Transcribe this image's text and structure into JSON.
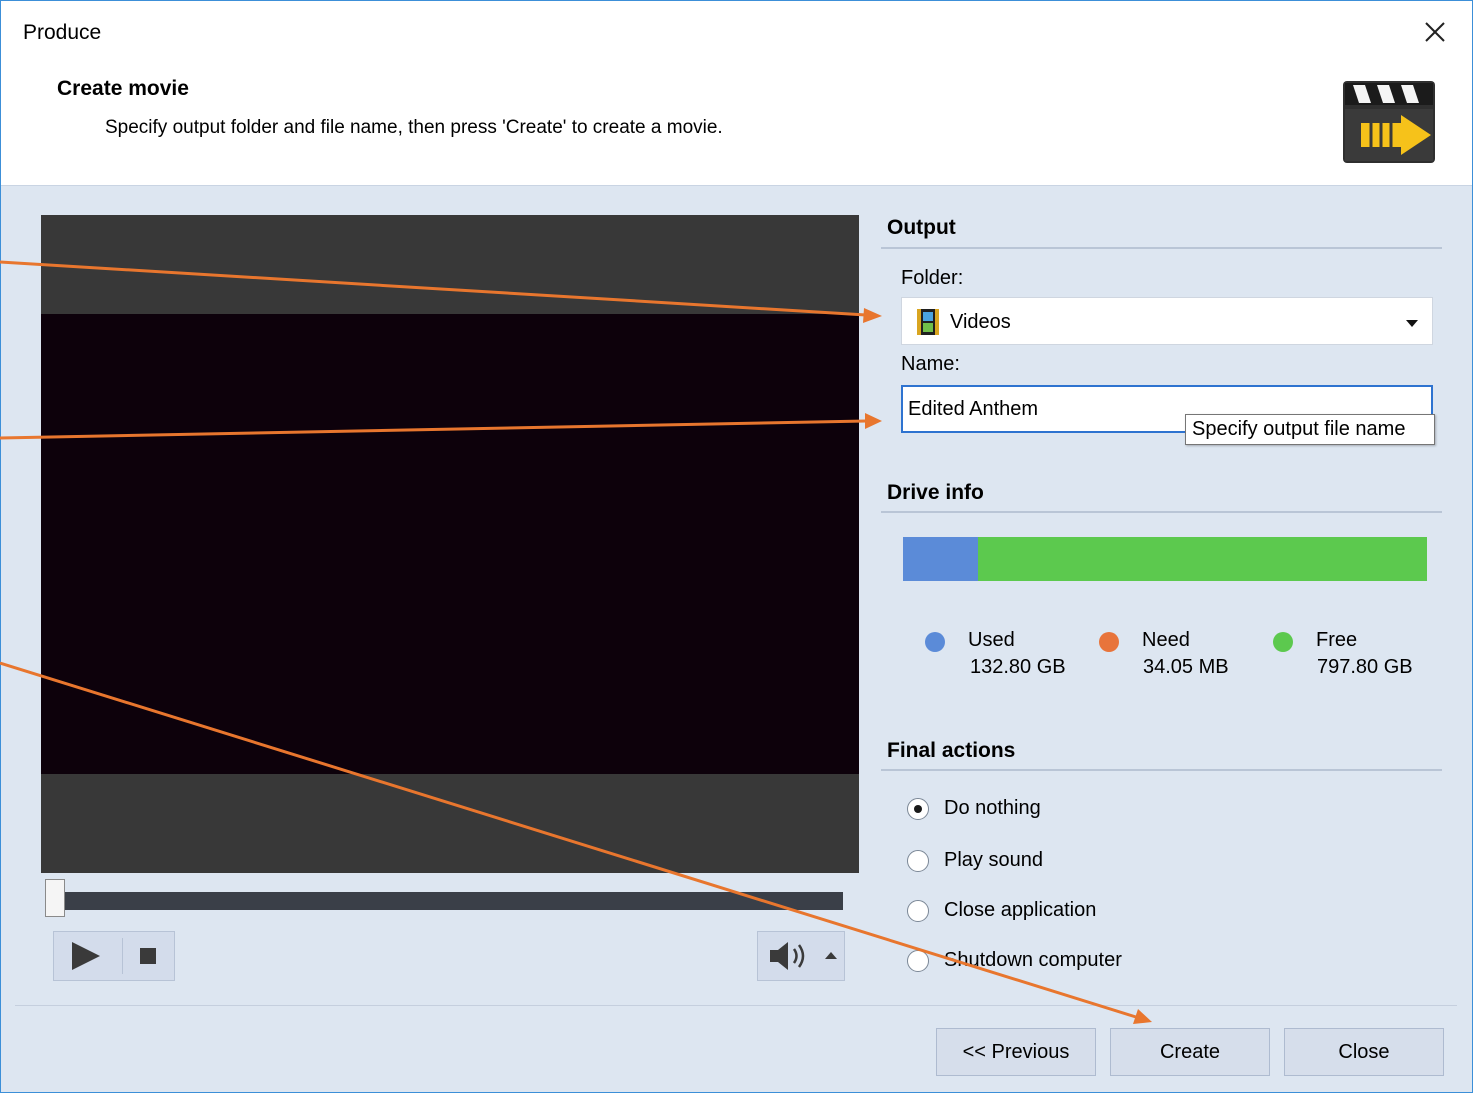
{
  "window": {
    "title": "Produce"
  },
  "header": {
    "title": "Create movie",
    "subtitle": "Specify output folder and file name, then press 'Create' to create a movie."
  },
  "icons": {
    "close": "close-icon",
    "clapperboard": "clapperboard-icon",
    "folder": "video-folder-icon",
    "dropdown": "chevron-down-icon",
    "play": "play-icon",
    "stop": "stop-icon",
    "volume": "speaker-icon",
    "volume_popup": "caret-up-icon"
  },
  "output": {
    "section_title": "Output",
    "folder_label": "Folder:",
    "folder_value": "Videos",
    "name_label": "Name:",
    "name_value": "Edited Anthem",
    "name_tooltip": "Specify output file name"
  },
  "drive_info": {
    "section_title": "Drive info",
    "used_fraction": 0.1427,
    "free_fraction": 0.8573,
    "legend": [
      {
        "name": "Used",
        "value": "132.80 GB",
        "color": "#5b8bd8"
      },
      {
        "name": "Need",
        "value": "34.05 MB",
        "color": "#e8743b"
      },
      {
        "name": "Free",
        "value": "797.80 GB",
        "color": "#5cc94e"
      }
    ]
  },
  "final_actions": {
    "section_title": "Final actions",
    "options": [
      {
        "label": "Do nothing",
        "selected": true
      },
      {
        "label": "Play sound",
        "selected": false
      },
      {
        "label": "Close application",
        "selected": false
      },
      {
        "label": "Shutdown computer",
        "selected": false
      }
    ]
  },
  "player": {
    "position_fraction": 0.0
  },
  "footer": {
    "previous_label": "<< Previous",
    "create_label": "Create",
    "close_label": "Close"
  },
  "colors": {
    "accent": "#2e73d0",
    "annotation_arrow": "#e8762e",
    "dialog_background": "#dde6f1",
    "video_background": "#0d010b"
  }
}
